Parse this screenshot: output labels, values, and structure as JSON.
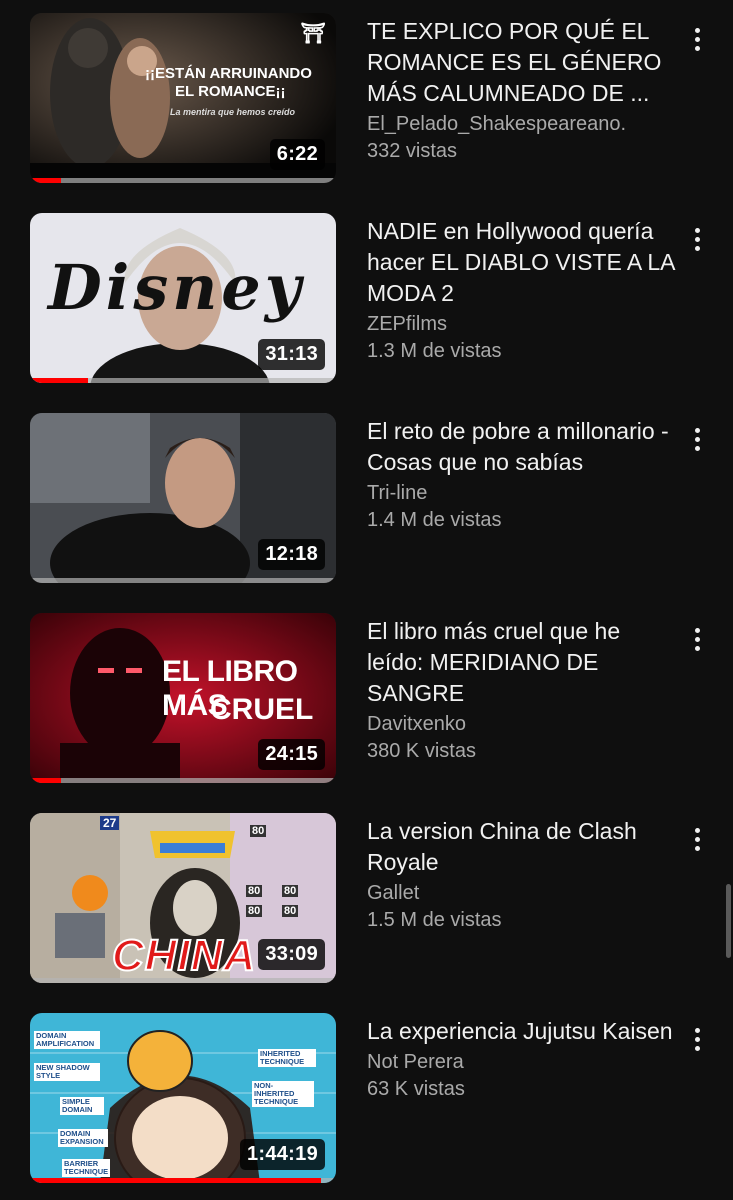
{
  "videos": [
    {
      "title": "TE EXPLICO POR QUÉ EL ROMANCE ES EL GÉNERO MÁS CALUMNEADO DE ...",
      "channel": "El_Pelado_Shakespeareano.",
      "views": "332 vistas",
      "duration": "6:22",
      "watched_fraction": 0.1,
      "thumb_text": {
        "line1": "¡¡ESTÁN ARRUINANDO",
        "line2": "EL ROMANCE¡¡",
        "subtitle": "La mentira que hemos creído",
        "logo": "⛩"
      }
    },
    {
      "title": "NADIE en Hollywood quería hacer EL DIABLO VISTE A LA MODA 2",
      "channel": "ZEPfilms",
      "views": "1.3 M de vistas",
      "duration": "31:13",
      "watched_fraction": 0.19,
      "thumb_text": {
        "logo": "Disney"
      }
    },
    {
      "title": "El reto de pobre a millonario - Cosas que no sabías",
      "channel": "Tri-line",
      "views": "1.4 M de vistas",
      "duration": "12:18",
      "watched_fraction": 0.0
    },
    {
      "title": "El libro más cruel que he leído: MERIDIANO DE SANGRE",
      "channel": "Davitxenko",
      "views": "380 K vistas",
      "duration": "24:15",
      "watched_fraction": 0.1,
      "thumb_text": {
        "line1": "EL LIBRO MÁS",
        "line2": "CRUEL"
      }
    },
    {
      "title": "La version China de Clash Royale",
      "channel": "Gallet",
      "views": "1.5 M de vistas",
      "duration": "33:09",
      "watched_fraction": 0.0,
      "thumb_text": {
        "word": "CHINA",
        "level": "27",
        "hp1": "80",
        "hp2": "80",
        "hp3": "80",
        "hp4": "80",
        "hp5": "80"
      }
    },
    {
      "title": "La experiencia Jujutsu Kaisen",
      "channel": "Not Perera",
      "views": "63 K vistas",
      "duration": "1:44:19",
      "watched_fraction": 0.95,
      "thumb_text": {
        "b1": "DOMAIN AMPLIFICATION",
        "b2": "NEW SHADOW STYLE",
        "b3": "SIMPLE DOMAIN",
        "b4": "DOMAIN EXPANSION",
        "b5": "BARRIER TECHNIQUE",
        "b6": "INHERITED TECHNIQUE",
        "b7": "NON-INHERITED TECHNIQUE"
      }
    }
  ],
  "icons": {
    "more": "more-vertical-icon"
  },
  "colors": {
    "background": "#0f0f0f",
    "progress": "#ff0000",
    "secondary_text": "#aaaaaa"
  }
}
